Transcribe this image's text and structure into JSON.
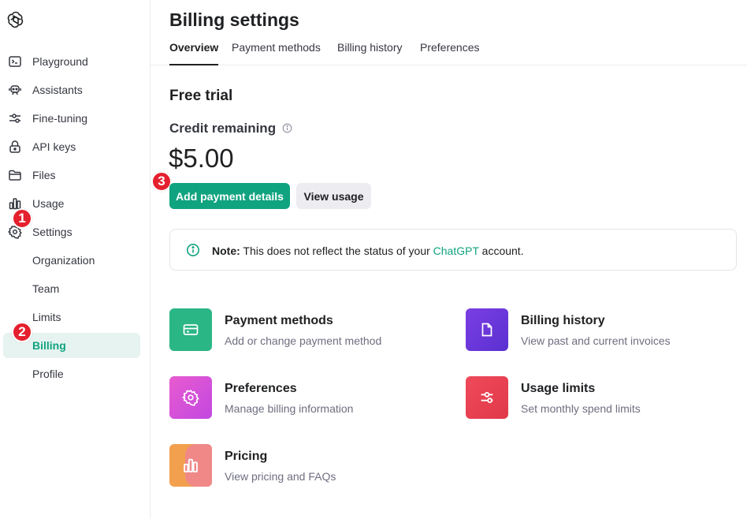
{
  "sidebar": {
    "items": [
      {
        "label": "Playground",
        "icon": "terminal-icon"
      },
      {
        "label": "Assistants",
        "icon": "robot-icon"
      },
      {
        "label": "Fine-tuning",
        "icon": "sliders-icon"
      },
      {
        "label": "API keys",
        "icon": "lock-icon"
      },
      {
        "label": "Files",
        "icon": "folder-icon"
      },
      {
        "label": "Usage",
        "icon": "bar-chart-icon"
      },
      {
        "label": "Settings",
        "icon": "gear-icon"
      }
    ],
    "settings_items": [
      {
        "label": "Organization"
      },
      {
        "label": "Team"
      },
      {
        "label": "Limits"
      },
      {
        "label": "Billing",
        "active": true
      },
      {
        "label": "Profile"
      }
    ]
  },
  "badges": [
    "1",
    "2",
    "3"
  ],
  "header": {
    "title": "Billing settings",
    "tabs": [
      {
        "label": "Overview",
        "active": true
      },
      {
        "label": "Payment methods"
      },
      {
        "label": "Billing history"
      },
      {
        "label": "Preferences"
      }
    ]
  },
  "overview": {
    "plan": "Free trial",
    "credit_label": "Credit remaining",
    "credit_amount": "$5.00",
    "primary_button": "Add payment details",
    "secondary_button": "View usage",
    "note": {
      "bold": "Note:",
      "text_before": " This does not reflect the status of your ",
      "link": "ChatGPT",
      "text_after": " account."
    }
  },
  "cards": [
    {
      "title": "Payment methods",
      "subtitle": "Add or change payment method",
      "icon": "credit-card-icon",
      "color": "#2bb686"
    },
    {
      "title": "Billing history",
      "subtitle": "View past and current invoices",
      "icon": "document-icon",
      "color": "#6e3fdb"
    },
    {
      "title": "Preferences",
      "subtitle": "Manage billing information",
      "icon": "gear-icon",
      "color": "#d655d8"
    },
    {
      "title": "Usage limits",
      "subtitle": "Set monthly spend limits",
      "icon": "sliders-icon",
      "color": "#e8404f"
    },
    {
      "title": "Pricing",
      "subtitle": "View pricing and FAQs",
      "icon": "bar-chart-icon",
      "color": "#f0a054"
    }
  ],
  "colors": {
    "accent": "#10a37f",
    "badge": "#e5202e",
    "active_bg": "#e6f3f0"
  }
}
